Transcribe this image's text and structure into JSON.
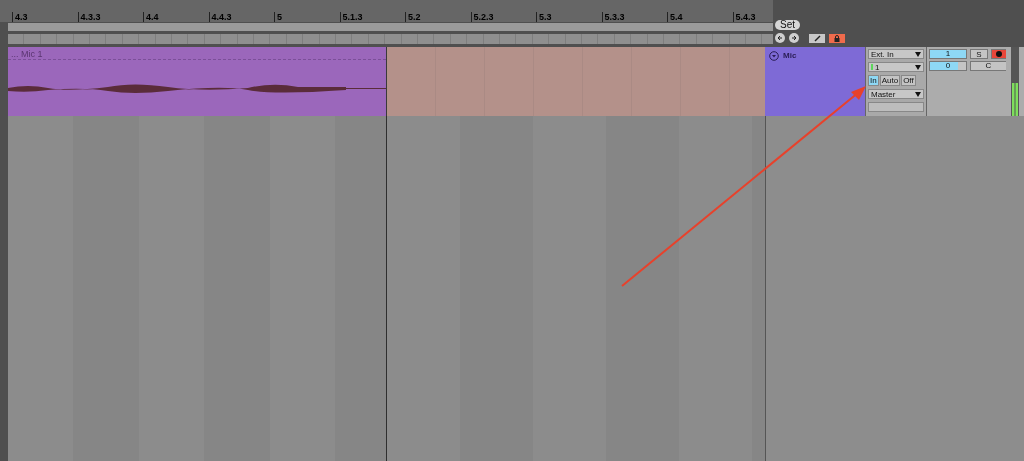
{
  "ruler": {
    "marks": [
      "4.3",
      "4.3.3",
      "4.4",
      "4.4.3",
      "5",
      "5.1.3",
      "5.2",
      "5.2.3",
      "5.3",
      "5.3.3",
      "5.4",
      "5.4.3"
    ]
  },
  "locators": {
    "set_label": "Set"
  },
  "clip": {
    "name": "... Mic 1"
  },
  "track": {
    "name": "Mic",
    "input_type": "Ext. In",
    "input_channel": "1",
    "output": "Master",
    "monitor": [
      {
        "label": "In",
        "selected": true
      },
      {
        "label": "Auto",
        "selected": false
      },
      {
        "label": "Off",
        "selected": false
      }
    ],
    "volume": "1",
    "pan": "0",
    "pan_center": "C",
    "solo": "S",
    "solo_on": false,
    "armed": true
  }
}
